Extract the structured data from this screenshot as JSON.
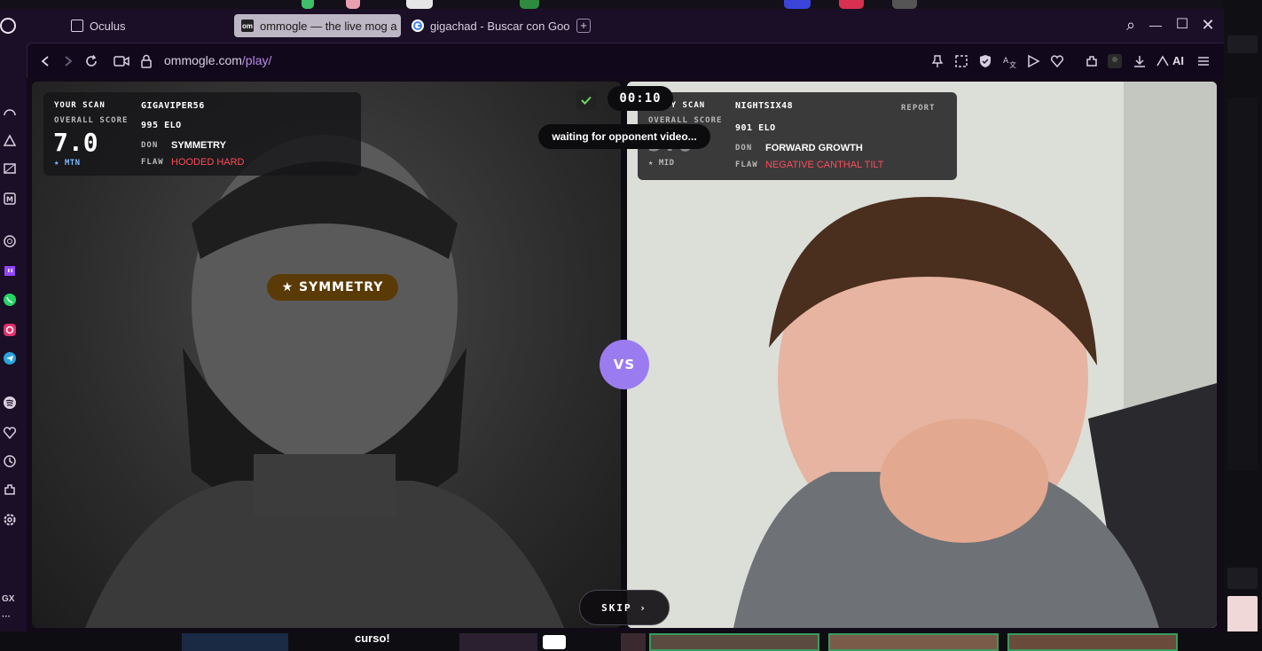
{
  "browser": {
    "tabs": [
      {
        "label": "Oculus",
        "active": false
      },
      {
        "label": "ommogle — the live mog a",
        "active": true
      },
      {
        "label": "gigachad - Buscar con Goo",
        "active": false
      }
    ],
    "favicon_om": "om",
    "newtab_label": "+",
    "window_controls": {
      "search": "⌕",
      "minimize": "—",
      "maximize": "☐",
      "close": "✕"
    },
    "url_domain": "ommogle.com",
    "url_path": "/play/",
    "ai_label": "AI",
    "sidebar_bottom_label": "GX",
    "sidebar_more": "···"
  },
  "colors": {
    "accent": "#9b7cf0",
    "flaw_red": "#ff4a5a",
    "tier_blue": "#7ab8ff",
    "badge_brown": "#5a3a06"
  },
  "game": {
    "timer": "00:10",
    "waiting_text": "waiting for opponent video...",
    "vs_label": "VS",
    "skip_label": "SKIP  ›",
    "left_badge": "★ SYMMETRY",
    "your_scan": {
      "title": "YOUR SCAN",
      "overall_label": "OVERALL SCORE",
      "score": "7.0",
      "tier": "★ MTN",
      "username": "GIGAVIPER56",
      "elo": "995 ELO",
      "don_label": "DON",
      "don_value": "SYMMETRY",
      "flaw_label": "FLAW",
      "flaw_value": "HOODED HARD"
    },
    "enemy_scan": {
      "title": "ENEMY SCAN",
      "overall_label": "OVERALL SCORE",
      "score": "5.6",
      "tier": "★ MID",
      "username": "NIGHTSIX48",
      "elo": "901 ELO",
      "don_label": "DON",
      "don_value": "FORWARD GROWTH",
      "flaw_label": "FLAW",
      "flaw_value": "NEGATIVE CANTHAL TILT",
      "report_label": "REPORT"
    }
  },
  "desktop": {
    "bottom_text": "curso!"
  }
}
